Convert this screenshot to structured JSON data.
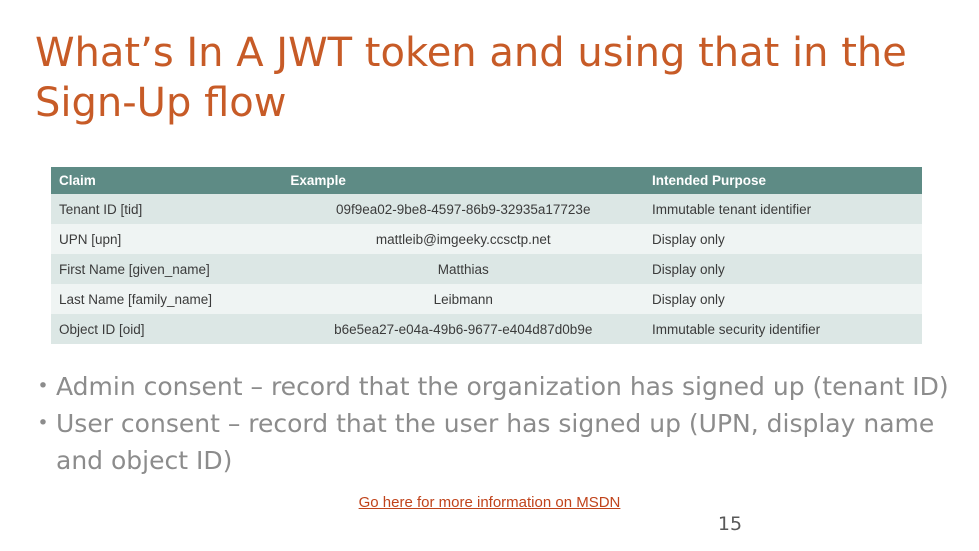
{
  "slide": {
    "title": "What’s In A JWT token and using that in the Sign-Up flow",
    "page_number": "15",
    "link_text": "Go here for more information on MSDN",
    "accent_color": "#C75B27",
    "table_header_color": "#5E8B85"
  },
  "table": {
    "headers": [
      "Claim",
      "Example",
      "Intended Purpose"
    ],
    "rows": [
      {
        "claim": "Tenant ID [tid]",
        "example": "09f9ea02-9be8-4597-86b9-32935a17723e",
        "purpose": "Immutable tenant identifier"
      },
      {
        "claim": "UPN [upn]",
        "example": "mattleib@imgeeky.ccsctp.net",
        "purpose": "Display only"
      },
      {
        "claim": "First Name [given_name]",
        "example": "Matthias",
        "purpose": "Display only"
      },
      {
        "claim": "Last Name [family_name]",
        "example": "Leibmann",
        "purpose": "Display only"
      },
      {
        "claim": "Object ID [oid]",
        "example": "b6e5ea27-e04a-49b6-9677-e404d87d0b9e",
        "purpose": "Immutable security identifier"
      }
    ]
  },
  "bullets": [
    {
      "marker": "•",
      "text": "Admin consent – record that the organization has signed up (tenant ID)"
    },
    {
      "marker": "•",
      "text": "User consent – record that the user has signed up (UPN, display name and object ID)"
    }
  ]
}
